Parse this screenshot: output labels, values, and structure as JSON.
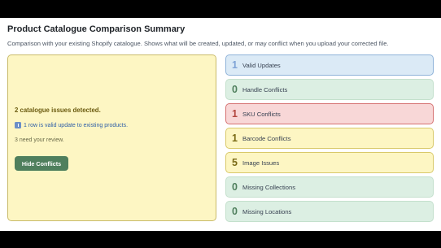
{
  "header": {
    "title": "Product Catalogue Comparison Summary",
    "subtitle": "Comparison with your existing Shopify catalogue. Shows what will be created, updated, or may conflict when you upload your corrected file."
  },
  "summary": {
    "issues_heading": "2 catalogue issues detected.",
    "valid_icon": "info-icon",
    "valid_text": "1 row is valid update to existing products.",
    "review_text": "3 need your review.",
    "hide_button_label": "Hide Conflicts"
  },
  "cards": [
    {
      "count": "1",
      "label": "Valid Updates",
      "bg": "#dbeaf6",
      "border": "#8fb3d9",
      "count_color": "#7fa3d6"
    },
    {
      "count": "0",
      "label": "Handle Conflicts",
      "bg": "#dcefe3",
      "border": "#c4e0cd",
      "count_color": "#4f7f5d"
    },
    {
      "count": "1",
      "label": "SKU Conflicts",
      "bg": "#f8d7d7",
      "border": "#d67272",
      "count_color": "#b3473f"
    },
    {
      "count": "1",
      "label": "Barcode Conflicts",
      "bg": "#fdf6c3",
      "border": "#d9c96a",
      "count_color": "#7a6a16"
    },
    {
      "count": "5",
      "label": "Image Issues",
      "bg": "#fdf6c3",
      "border": "#d9c96a",
      "count_color": "#7a6a16"
    },
    {
      "count": "0",
      "label": "Missing Collections",
      "bg": "#dcefe3",
      "border": "#c4e0cd",
      "count_color": "#4f7f5d"
    },
    {
      "count": "0",
      "label": "Missing Locations",
      "bg": "#dcefe3",
      "border": "#c4e0cd",
      "count_color": "#4f7f5d"
    }
  ]
}
